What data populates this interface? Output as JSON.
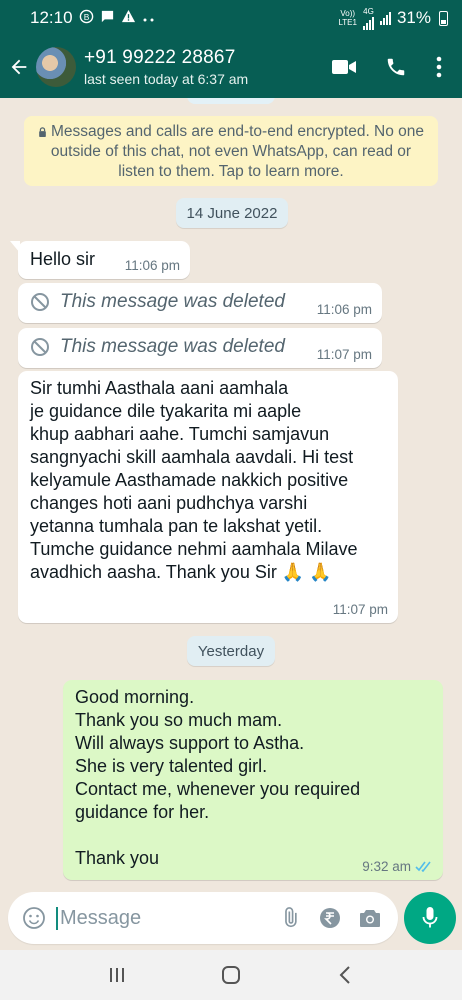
{
  "status": {
    "time": "12:10",
    "network_top": "Vo))",
    "network_bottom": "LTE1",
    "network_gen": "4G",
    "battery": "31%"
  },
  "header": {
    "contact_name": "+91 99222 28867",
    "last_seen": "last seen today at 6:37 am"
  },
  "encryption_notice": "Messages and calls are end-to-end encrypted. No one outside of this chat, not even WhatsApp, can read or listen to them. Tap to learn more.",
  "dates": {
    "first": "14 June 2022",
    "second": "Yesterday"
  },
  "messages": [
    {
      "direction": "in",
      "text": "Hello sir",
      "time": "11:06 pm"
    },
    {
      "direction": "in",
      "deleted": true,
      "text": "This message was deleted",
      "time": "11:06 pm"
    },
    {
      "direction": "in",
      "deleted": true,
      "text": "This message was deleted",
      "time": "11:07 pm"
    },
    {
      "direction": "in",
      "text": "Sir tumhi Aasthala aani aamhala\nje guidance dile tyakarita mi aaple\nkhup aabhari aahe. Tumchi samjavun\nsangnyachi skill aamhala aavdali. Hi test\nkelyamule Aasthamade nakkich positive\nchanges hoti aani pudhchya varshi\nyetanna tumhala pan te lakshat yetil.\nTumche guidance nehmi aamhala Milave\navadhich aasha. Thank you Sir 🙏 🙏",
      "time": "11:07 pm"
    },
    {
      "direction": "out",
      "text": "Good morning.\nThank you so much mam.\nWill always support to Astha.\nShe is very talented girl.\nContact me, whenever you required\nguidance for her.\n\nThank you",
      "time": "9:32 am",
      "status": "read"
    }
  ],
  "input": {
    "placeholder": "Message"
  },
  "colors": {
    "header_bg": "#075e54",
    "chat_bg": "#efe7dd",
    "incoming_bubble": "#ffffff",
    "outgoing_bubble": "#dcf8c6",
    "accent": "#00a884",
    "read_ticks": "#53bdeb"
  },
  "icons": [
    "back-arrow-icon",
    "video-call-icon",
    "phone-icon",
    "more-vert-icon",
    "lock-icon",
    "ban-icon",
    "emoji-icon",
    "attach-icon",
    "rupee-icon",
    "camera-icon",
    "mic-icon",
    "double-check-icon"
  ]
}
